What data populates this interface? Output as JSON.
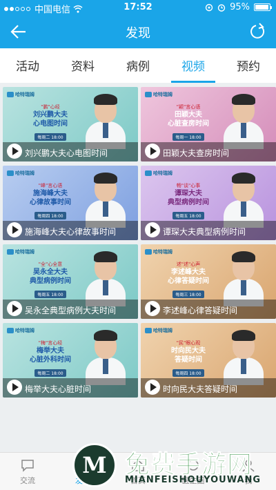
{
  "status_bar": {
    "carrier": "中国电信",
    "time": "17:52",
    "battery": "95%"
  },
  "header": {
    "title": "发现",
    "back_icon": "arrow-left-icon",
    "refresh_icon": "refresh-icon"
  },
  "tabs": [
    {
      "label": "活动",
      "active": false
    },
    {
      "label": "资料",
      "active": false
    },
    {
      "label": "病例",
      "active": false
    },
    {
      "label": "视频",
      "active": true
    },
    {
      "label": "预约",
      "active": false
    }
  ],
  "cards": [
    {
      "caption": "刘兴鹏大夫心电图时间",
      "promo_small": "\"鹏\"心经",
      "promo_name": "刘兴鹏大夫",
      "promo_line2": "心电图时间",
      "promo_time": "每周二 18:00",
      "brand": "哈特瑞姆",
      "bg": "#7cc9c6"
    },
    {
      "caption": "田颖大夫查房时间",
      "promo_small": "\"颖\"言心语",
      "promo_name": "田颖大夫",
      "promo_line2": "心脏查房时间",
      "promo_time": "每周一 18:00",
      "brand": "哈特瑞姆",
      "bg": "#d48cb9"
    },
    {
      "caption": "施海峰大夫心律故事时间",
      "promo_small": "\"峰\"言心语",
      "promo_name": "施海峰大夫",
      "promo_line2": "心律故事时间",
      "promo_time": "每周四 18:00",
      "brand": "哈特瑞姆",
      "bg": "#7d9fe0"
    },
    {
      "caption": "谭琛大夫典型病例时间",
      "promo_small": "畅\"谈\"心事",
      "promo_name": "谭琛大夫",
      "promo_line2": "典型病例时间",
      "promo_time": "每周五 18:00",
      "brand": "哈特瑞姆",
      "bg": "#b892de"
    },
    {
      "caption": "吴永全典型病例大夫时间",
      "promo_small": "\"全\"心全意",
      "promo_name": "吴永全大夫",
      "promo_line2": "典型病例时间",
      "promo_time": "每周五 18:00",
      "brand": "哈特瑞姆",
      "bg": "#7cc9c6"
    },
    {
      "caption": "李述峰心律答疑时间",
      "promo_small": "述\"述\"心声",
      "promo_name": "李述峰大夫",
      "promo_line2": "心律答疑时间",
      "promo_time": "每周三 18:00",
      "brand": "哈特瑞姆",
      "bg": "#d9a56f"
    },
    {
      "caption": "梅举大夫心脏时间",
      "promo_small": "\"梅\"言心经",
      "promo_name": "梅举大夫",
      "promo_line2": "心脏外科时间",
      "promo_time": "每周二 18:00",
      "brand": "哈特瑞姆",
      "bg": "#7cc9c6"
    },
    {
      "caption": "时向民大夫答疑时间",
      "promo_small": "\"民\"眼心观",
      "promo_name": "时向民大夫",
      "promo_line2": "答疑时间",
      "promo_time": "每周四 18:00",
      "brand": "哈特瑞姆",
      "bg": "#d9a56f"
    }
  ],
  "bottom_nav": [
    {
      "label": "交流",
      "icon": "chat-icon",
      "active": false
    },
    {
      "label": "发现",
      "icon": "compass-icon",
      "active": true
    },
    {
      "label": "首页",
      "icon": "home-icon",
      "active": false
    },
    {
      "label": "医生圈",
      "icon": "circle-icon",
      "active": false
    },
    {
      "label": "我",
      "icon": "user-icon",
      "active": false
    }
  ],
  "watermark": {
    "title": "免费手游网",
    "subtitle": "MIANFEISHOUYOUWANG"
  },
  "colors": {
    "accent": "#1aa5e8"
  }
}
